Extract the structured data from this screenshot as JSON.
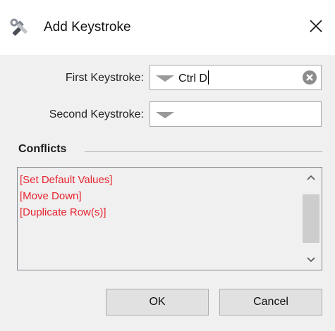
{
  "window": {
    "title": "Add Keystroke",
    "icon": "tools-icon",
    "close_icon": "close-icon"
  },
  "first_keystroke": {
    "label": "First Keystroke:",
    "value": "Ctrl D",
    "clear_icon": "clear-icon"
  },
  "second_keystroke": {
    "label": "Second Keystroke:",
    "value": ""
  },
  "conflicts": {
    "title": "Conflicts",
    "items": [
      "[Set Default Values]",
      "[Move Down]",
      "[Duplicate Row(s)]"
    ],
    "item_color": "#e8242f"
  },
  "buttons": {
    "ok": "OK",
    "cancel": "Cancel"
  }
}
